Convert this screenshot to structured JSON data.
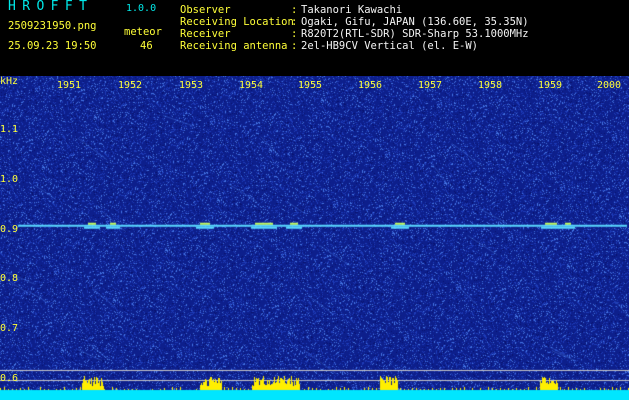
{
  "header": {
    "app_title": "HROFFT",
    "version": "1.0.0",
    "filename": "2509231950.png",
    "meteor_label": "meteor",
    "datetime": "25.09.23 19:50",
    "meteor_count": "46"
  },
  "info": [
    {
      "key": "Observer",
      "sep": ":",
      "value": "Takanori Kawachi"
    },
    {
      "key": "Receiving Location",
      "sep": ":",
      "value": "Ogaki, Gifu, JAPAN (136.60E, 35.35N)"
    },
    {
      "key": "Receiver",
      "sep": ":",
      "value": "R820T2(RTL-SDR) SDR-Sharp 53.1000MHz"
    },
    {
      "key": "Receiving antenna",
      "sep": ":",
      "value": "2el-HB9CV Vertical (el. E-W)"
    }
  ],
  "chart_data": {
    "type": "heatmap",
    "ylabel": "kHz",
    "x_ticks": [
      "1951",
      "1952",
      "1953",
      "1954",
      "1955",
      "1956",
      "1957",
      "1958",
      "1959",
      "2000"
    ],
    "y_ticks": [
      "1.1",
      "1.0",
      "0.9",
      "0.8",
      "0.7",
      "0.6"
    ],
    "ylim": [
      0.58,
      1.18
    ],
    "carrier_khz": 0.905,
    "colors": {
      "background": "#0d1f8c",
      "noise": "#3f6fd8",
      "carrier": "#59d8ff",
      "bottom_band": "#00e6ff",
      "meteor_bar": "#ffef00",
      "grid": "#c8c8c8"
    }
  }
}
